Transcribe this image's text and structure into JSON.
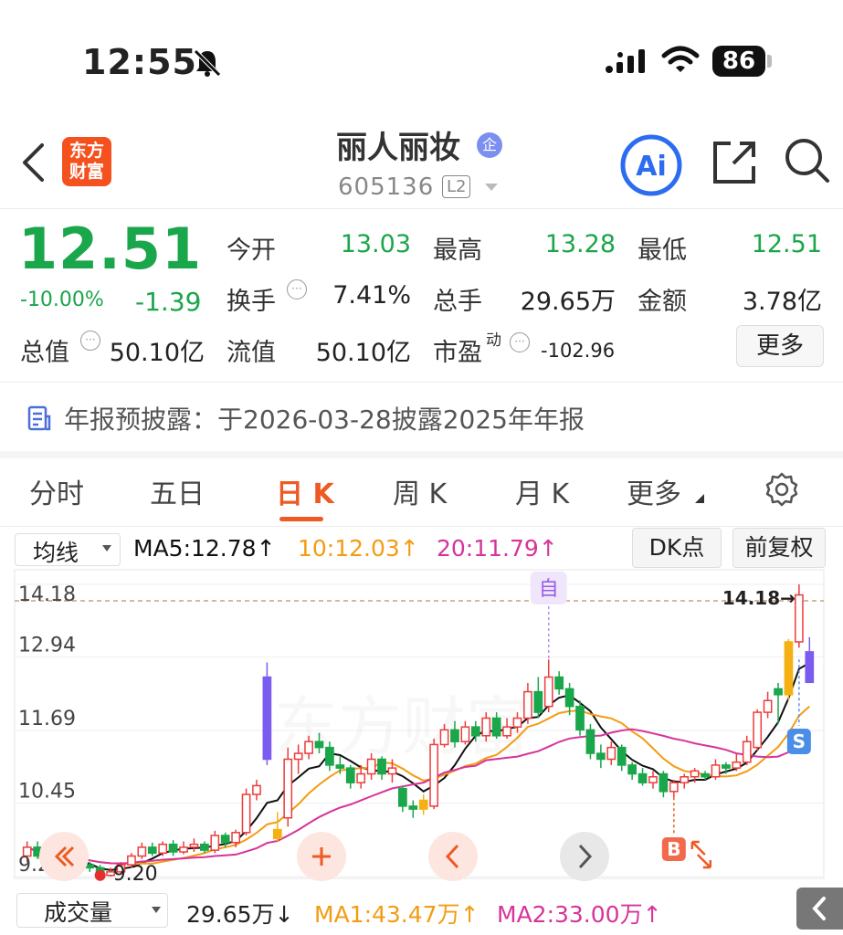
{
  "status_bar": {
    "time": "12:55",
    "battery": "86"
  },
  "header": {
    "logo_text_line1": "东方",
    "logo_text_line2": "财富",
    "stock_name": "丽人丽妆",
    "badge": "企",
    "stock_code": "605136",
    "level": "L2",
    "ai_label": "Ai"
  },
  "quote": {
    "price": "12.51",
    "change_pct": "-10.00%",
    "change": "-1.39",
    "fields": {
      "open_label": "今开",
      "open": "13.03",
      "high_label": "最高",
      "high": "13.28",
      "low_label": "最低",
      "low": "12.51",
      "turnover_label": "换手",
      "turnover": "7.41%",
      "volume_label": "总手",
      "volume": "29.65万",
      "amount_label": "金额",
      "amount": "3.78亿",
      "mcap_label": "总值",
      "mcap": "50.10亿",
      "float_label": "流值",
      "float": "50.10亿",
      "pe_label": "市盈",
      "pe_sup": "动",
      "pe": "-102.96"
    },
    "more_label": "更多",
    "dots_glyph": "···"
  },
  "notice": {
    "text": "年报预披露：于2026-03-28披露2025年年报"
  },
  "tabs": [
    {
      "label": "分时"
    },
    {
      "label": "五日"
    },
    {
      "label": "日 K"
    },
    {
      "label": "周 K"
    },
    {
      "label": "月 K"
    },
    {
      "label": "更多"
    }
  ],
  "ma_bar": {
    "select": "均线",
    "ma5": "MA5:12.78↑",
    "ma10": "10:12.03↑",
    "ma20": "20:11.79↑",
    "dk": "DK点",
    "fq": "前复权"
  },
  "colors": {
    "up": "#ee3b3b",
    "down": "#1aa64a",
    "ma5": "#111111",
    "ma10": "#f39c12",
    "ma20": "#d6349a",
    "limit_down": "#7b5cf0",
    "limit_up": "#f5b114"
  },
  "chart_data": {
    "type": "candlestick",
    "y_ticks": [
      "14.18",
      "12.94",
      "11.69",
      "10.45",
      "9.20"
    ],
    "ylim": [
      9.2,
      14.18
    ],
    "high_marker": "14.18→",
    "low_marker": "9.20",
    "signal_labels": {
      "self": "自",
      "sell": "S",
      "buy": "B"
    },
    "candles": [
      {
        "o": 9.55,
        "c": 9.7,
        "h": 9.8,
        "l": 9.45
      },
      {
        "o": 9.7,
        "c": 9.55,
        "h": 9.8,
        "l": 9.5
      },
      {
        "o": 9.55,
        "c": 9.62,
        "h": 9.75,
        "l": 9.45
      },
      {
        "o": 9.62,
        "c": 9.42,
        "h": 9.7,
        "l": 9.35
      },
      {
        "o": 9.42,
        "c": 9.3,
        "h": 9.5,
        "l": 9.22
      },
      {
        "o": 9.3,
        "c": 9.4,
        "h": 9.5,
        "l": 9.25
      },
      {
        "o": 9.4,
        "c": 9.35,
        "h": 9.45,
        "l": 9.28
      },
      {
        "o": 9.35,
        "c": 9.22,
        "h": 9.4,
        "l": 9.2
      },
      {
        "o": 9.22,
        "c": 9.28,
        "h": 9.35,
        "l": 9.2
      },
      {
        "o": 9.28,
        "c": 9.4,
        "h": 9.45,
        "l": 9.25
      },
      {
        "o": 9.4,
        "c": 9.55,
        "h": 9.6,
        "l": 9.35
      },
      {
        "o": 9.55,
        "c": 9.7,
        "h": 9.78,
        "l": 9.5
      },
      {
        "o": 9.7,
        "c": 9.6,
        "h": 9.78,
        "l": 9.55
      },
      {
        "o": 9.6,
        "c": 9.75,
        "h": 9.8,
        "l": 9.55
      },
      {
        "o": 9.75,
        "c": 9.62,
        "h": 9.82,
        "l": 9.55
      },
      {
        "o": 9.62,
        "c": 9.7,
        "h": 9.8,
        "l": 9.58
      },
      {
        "o": 9.7,
        "c": 9.75,
        "h": 9.85,
        "l": 9.62
      },
      {
        "o": 9.75,
        "c": 9.65,
        "h": 9.8,
        "l": 9.6
      },
      {
        "o": 9.65,
        "c": 9.9,
        "h": 9.98,
        "l": 9.6
      },
      {
        "o": 9.9,
        "c": 9.78,
        "h": 9.95,
        "l": 9.7
      },
      {
        "o": 9.78,
        "c": 9.95,
        "h": 10.0,
        "l": 9.7
      },
      {
        "o": 9.95,
        "c": 10.6,
        "h": 10.7,
        "l": 9.9
      },
      {
        "o": 10.6,
        "c": 10.75,
        "h": 10.85,
        "l": 10.5
      },
      {
        "o": 12.6,
        "c": 11.2,
        "h": 12.85,
        "l": 11.1
      },
      {
        "o": 9.85,
        "c": 10.0,
        "h": 10.3,
        "l": 9.8
      },
      {
        "o": 10.2,
        "c": 11.2,
        "h": 11.4,
        "l": 10.05
      },
      {
        "o": 11.2,
        "c": 11.3,
        "h": 11.45,
        "l": 10.95
      },
      {
        "o": 11.3,
        "c": 11.5,
        "h": 11.6,
        "l": 11.2
      },
      {
        "o": 11.5,
        "c": 11.4,
        "h": 11.65,
        "l": 11.3
      },
      {
        "o": 11.4,
        "c": 11.1,
        "h": 11.5,
        "l": 11.0
      },
      {
        "o": 11.1,
        "c": 11.05,
        "h": 11.25,
        "l": 10.95
      },
      {
        "o": 11.05,
        "c": 10.8,
        "h": 11.1,
        "l": 10.7
      },
      {
        "o": 10.8,
        "c": 10.95,
        "h": 11.1,
        "l": 10.7
      },
      {
        "o": 10.95,
        "c": 11.2,
        "h": 11.3,
        "l": 10.85
      },
      {
        "o": 11.2,
        "c": 10.95,
        "h": 11.25,
        "l": 10.85
      },
      {
        "o": 10.95,
        "c": 11.05,
        "h": 11.2,
        "l": 10.8
      },
      {
        "o": 10.7,
        "c": 10.4,
        "h": 10.75,
        "l": 10.3
      },
      {
        "o": 10.4,
        "c": 10.35,
        "h": 10.5,
        "l": 10.2
      },
      {
        "o": 10.35,
        "c": 10.5,
        "h": 10.6,
        "l": 10.25
      },
      {
        "o": 10.4,
        "c": 11.45,
        "h": 11.55,
        "l": 10.35
      },
      {
        "o": 11.45,
        "c": 11.7,
        "h": 11.8,
        "l": 11.4
      },
      {
        "o": 11.7,
        "c": 11.5,
        "h": 11.85,
        "l": 11.4
      },
      {
        "o": 11.5,
        "c": 11.75,
        "h": 11.85,
        "l": 11.45
      },
      {
        "o": 11.75,
        "c": 11.6,
        "h": 11.85,
        "l": 11.5
      },
      {
        "o": 11.6,
        "c": 11.9,
        "h": 12.0,
        "l": 11.5
      },
      {
        "o": 11.9,
        "c": 11.6,
        "h": 12.0,
        "l": 11.55
      },
      {
        "o": 11.6,
        "c": 11.75,
        "h": 11.9,
        "l": 11.55
      },
      {
        "o": 11.75,
        "c": 11.9,
        "h": 12.0,
        "l": 11.65
      },
      {
        "o": 11.9,
        "c": 12.35,
        "h": 12.5,
        "l": 11.8
      },
      {
        "o": 12.35,
        "c": 12.0,
        "h": 12.6,
        "l": 11.9
      },
      {
        "o": 12.1,
        "c": 12.6,
        "h": 12.9,
        "l": 12.0
      },
      {
        "o": 12.6,
        "c": 12.4,
        "h": 12.7,
        "l": 12.3
      },
      {
        "o": 12.4,
        "c": 12.1,
        "h": 12.5,
        "l": 11.95
      },
      {
        "o": 12.1,
        "c": 11.7,
        "h": 12.2,
        "l": 11.6
      },
      {
        "o": 11.7,
        "c": 11.3,
        "h": 11.8,
        "l": 11.2
      },
      {
        "o": 11.3,
        "c": 11.2,
        "h": 11.45,
        "l": 11.05
      },
      {
        "o": 11.2,
        "c": 11.4,
        "h": 11.5,
        "l": 11.1
      },
      {
        "o": 11.4,
        "c": 11.1,
        "h": 11.45,
        "l": 11.0
      },
      {
        "o": 11.1,
        "c": 10.95,
        "h": 11.15,
        "l": 10.85
      },
      {
        "o": 10.95,
        "c": 10.8,
        "h": 11.05,
        "l": 10.75
      },
      {
        "o": 10.8,
        "c": 10.9,
        "h": 11.0,
        "l": 10.7
      },
      {
        "o": 10.95,
        "c": 10.65,
        "h": 11.0,
        "l": 10.55
      },
      {
        "o": 10.65,
        "c": 10.8,
        "h": 10.85,
        "l": 10.55
      },
      {
        "o": 10.8,
        "c": 10.9,
        "h": 10.95,
        "l": 10.7
      },
      {
        "o": 10.9,
        "c": 11.0,
        "h": 11.05,
        "l": 10.8
      },
      {
        "o": 10.95,
        "c": 10.9,
        "h": 11.0,
        "l": 10.85
      },
      {
        "o": 10.9,
        "c": 11.1,
        "h": 11.2,
        "l": 10.85
      },
      {
        "o": 11.1,
        "c": 11.05,
        "h": 11.15,
        "l": 10.95
      },
      {
        "o": 11.05,
        "c": 11.15,
        "h": 11.3,
        "l": 11.0
      },
      {
        "o": 11.15,
        "c": 11.5,
        "h": 11.6,
        "l": 11.1
      },
      {
        "o": 11.4,
        "c": 12.0,
        "h": 12.05,
        "l": 11.35
      },
      {
        "o": 12.0,
        "c": 12.2,
        "h": 12.35,
        "l": 11.9
      },
      {
        "o": 12.4,
        "c": 12.3,
        "h": 12.5,
        "l": 11.8
      },
      {
        "o": 12.3,
        "c": 13.2,
        "h": 13.25,
        "l": 12.2
      },
      {
        "o": 13.2,
        "c": 14.0,
        "h": 14.18,
        "l": 13.1
      },
      {
        "o": 13.03,
        "c": 12.51,
        "h": 13.28,
        "l": 12.51
      }
    ],
    "candle_styles": {
      "23": "limit_down",
      "38": "limit_up",
      "24": "limit_up",
      "73": "limit_up",
      "75": "limit_down"
    }
  },
  "volume_bar": {
    "select": "成交量",
    "vol": "29.65万↓",
    "ma1": "MA1:43.47万↑",
    "ma2": "MA2:33.00万↑"
  }
}
